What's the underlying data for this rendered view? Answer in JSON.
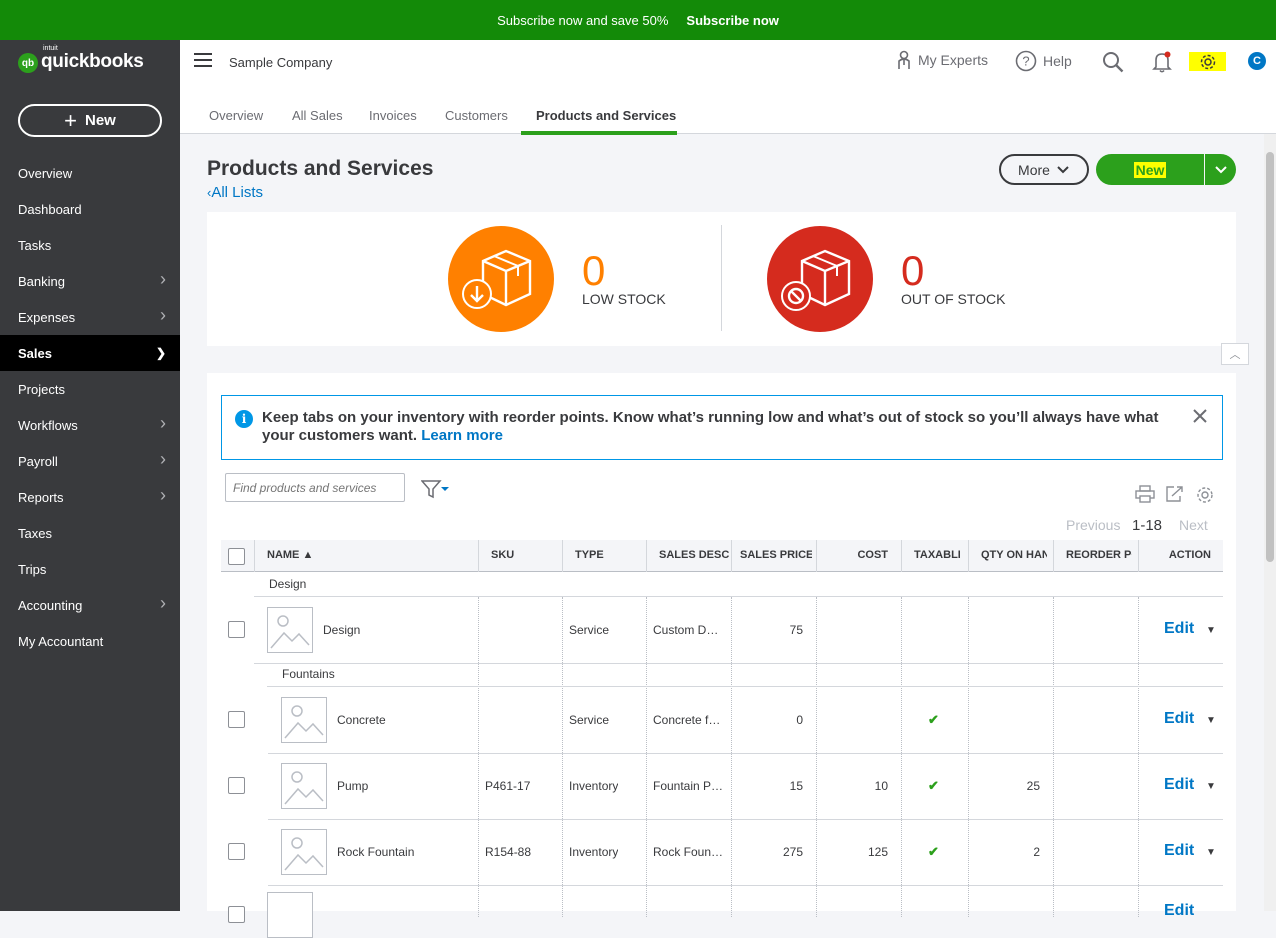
{
  "promo": {
    "text": "Subscribe now and save 50%",
    "cta": "Subscribe now"
  },
  "brand": {
    "small": "intuit",
    "name": "quickbooks",
    "mark": "qb"
  },
  "sidebar": {
    "new_label": "New",
    "items": [
      {
        "label": "Overview",
        "chevron": false
      },
      {
        "label": "Dashboard",
        "chevron": false
      },
      {
        "label": "Tasks",
        "chevron": false
      },
      {
        "label": "Banking",
        "chevron": true
      },
      {
        "label": "Expenses",
        "chevron": true
      },
      {
        "label": "Sales",
        "chevron": true,
        "active": true
      },
      {
        "label": "Projects",
        "chevron": false
      },
      {
        "label": "Workflows",
        "chevron": true
      },
      {
        "label": "Payroll",
        "chevron": true
      },
      {
        "label": "Reports",
        "chevron": true
      },
      {
        "label": "Taxes",
        "chevron": false
      },
      {
        "label": "Trips",
        "chevron": false
      },
      {
        "label": "Accounting",
        "chevron": true
      },
      {
        "label": "My Accountant",
        "chevron": false
      }
    ]
  },
  "topbar": {
    "company": "Sample Company",
    "experts": "My Experts",
    "help": "Help",
    "avatar": "C"
  },
  "tabs": [
    "Overview",
    "All Sales",
    "Invoices",
    "Customers",
    "Products and Services"
  ],
  "page": {
    "title": "Products and Services",
    "back_link": "All Lists",
    "more_label": "More",
    "new_label": "New"
  },
  "stock": {
    "low": {
      "count": "0",
      "label": "LOW STOCK",
      "color": "#ff8000"
    },
    "out": {
      "count": "0",
      "label": "OUT OF STOCK",
      "color": "#d52b1e"
    }
  },
  "banner": {
    "text": "Keep tabs on your inventory with reorder points. Know what’s running low and what’s out of stock so you’ll always have what your customers want.",
    "link": "Learn more"
  },
  "search": {
    "placeholder": "Find products and services"
  },
  "pager": {
    "prev": "Previous",
    "range": "1-18",
    "next": "Next"
  },
  "table": {
    "headers": [
      "NAME ▲",
      "SKU",
      "TYPE",
      "SALES DESCRI",
      "SALES PRICE",
      "COST",
      "TAXABLE",
      "QTY ON HAND",
      "REORDER POI",
      "ACTION"
    ],
    "groups": [
      "Design",
      "Fountains"
    ],
    "rows": [
      {
        "name": "Design",
        "sku": "",
        "type": "Service",
        "desc": "Custom D…",
        "price": "75",
        "cost": "",
        "taxable": false,
        "qty": "",
        "action": "Edit"
      },
      {
        "name": "Concrete",
        "sku": "",
        "type": "Service",
        "desc": "Concrete f…",
        "price": "0",
        "cost": "",
        "taxable": true,
        "qty": "",
        "action": "Edit"
      },
      {
        "name": "Pump",
        "sku": "P461-17",
        "type": "Inventory",
        "desc": "Fountain P…",
        "price": "15",
        "cost": "10",
        "taxable": true,
        "qty": "25",
        "action": "Edit"
      },
      {
        "name": "Rock Fountain",
        "sku": "R154-88",
        "type": "Inventory",
        "desc": "Rock Foun…",
        "price": "275",
        "cost": "125",
        "taxable": true,
        "qty": "2",
        "action": "Edit"
      }
    ]
  }
}
